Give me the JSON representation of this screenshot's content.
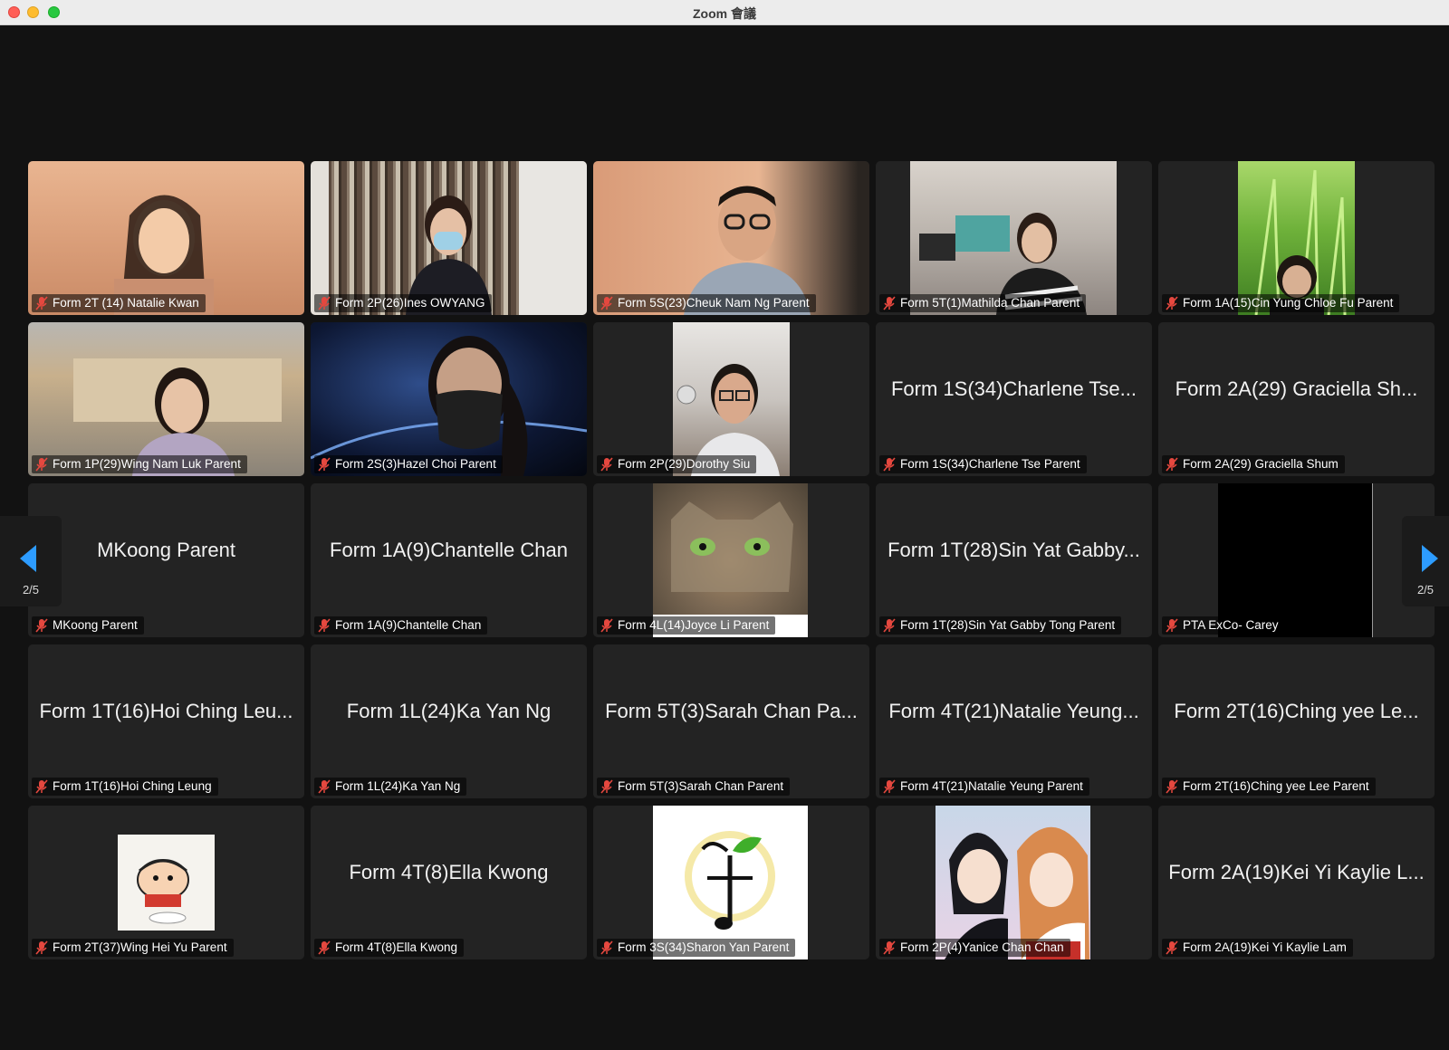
{
  "window": {
    "title": "Zoom 會議"
  },
  "nav": {
    "prev_page": "2/5",
    "next_page": "2/5"
  },
  "tiles": [
    {
      "label": "Form 2T (14) Natalie Kwan",
      "name_display": ""
    },
    {
      "label": "Form 2P(26)Ines OWYANG",
      "name_display": ""
    },
    {
      "label": "Form 5S(23)Cheuk Nam Ng Parent",
      "name_display": ""
    },
    {
      "label": "Form 5T(1)Mathilda Chan Parent",
      "name_display": ""
    },
    {
      "label": "Form 1A(15)Cin Yung Chloe Fu Parent",
      "name_display": ""
    },
    {
      "label": "Form 1P(29)Wing Nam Luk Parent",
      "name_display": ""
    },
    {
      "label": "Form 2S(3)Hazel Choi Parent",
      "name_display": ""
    },
    {
      "label": "Form 2P(29)Dorothy Siu",
      "name_display": ""
    },
    {
      "label": "Form 1S(34)Charlene Tse Parent",
      "name_display": "Form 1S(34)Charlene Tse..."
    },
    {
      "label": "Form 2A(29) Graciella Shum",
      "name_display": "Form 2A(29) Graciella Sh..."
    },
    {
      "label": "MKoong Parent",
      "name_display": "MKoong Parent"
    },
    {
      "label": "Form 1A(9)Chantelle Chan",
      "name_display": "Form 1A(9)Chantelle Chan"
    },
    {
      "label": "Form 4L(14)Joyce Li Parent",
      "name_display": ""
    },
    {
      "label": "Form 1T(28)Sin Yat Gabby Tong Parent",
      "name_display": "Form 1T(28)Sin Yat Gabby..."
    },
    {
      "label": "PTA ExCo- Carey",
      "name_display": ""
    },
    {
      "label": "Form 1T(16)Hoi Ching Leung",
      "name_display": "Form 1T(16)Hoi Ching Leu..."
    },
    {
      "label": "Form 1L(24)Ka Yan Ng",
      "name_display": "Form 1L(24)Ka Yan Ng"
    },
    {
      "label": "Form 5T(3)Sarah Chan Parent",
      "name_display": "Form 5T(3)Sarah Chan Pa..."
    },
    {
      "label": "Form 4T(21)Natalie Yeung Parent",
      "name_display": "Form 4T(21)Natalie Yeung..."
    },
    {
      "label": "Form 2T(16)Ching yee Lee Parent",
      "name_display": "Form 2T(16)Ching yee Le..."
    },
    {
      "label": "Form 2T(37)Wing Hei Yu Parent",
      "name_display": ""
    },
    {
      "label": "Form 4T(8)Ella Kwong",
      "name_display": "Form 4T(8)Ella Kwong"
    },
    {
      "label": "Form 3S(34)Sharon Yan Parent",
      "name_display": ""
    },
    {
      "label": "Form 2P(4)Yanice Chan Chan",
      "name_display": ""
    },
    {
      "label": "Form 2A(19)Kei Yi Kaylie Lam",
      "name_display": "Form 2A(19)Kei Yi Kaylie L..."
    }
  ],
  "colors": {
    "accent": "#2d9cff",
    "muted_mic": "#e5483f",
    "background": "#121212",
    "tile": "#232323"
  }
}
